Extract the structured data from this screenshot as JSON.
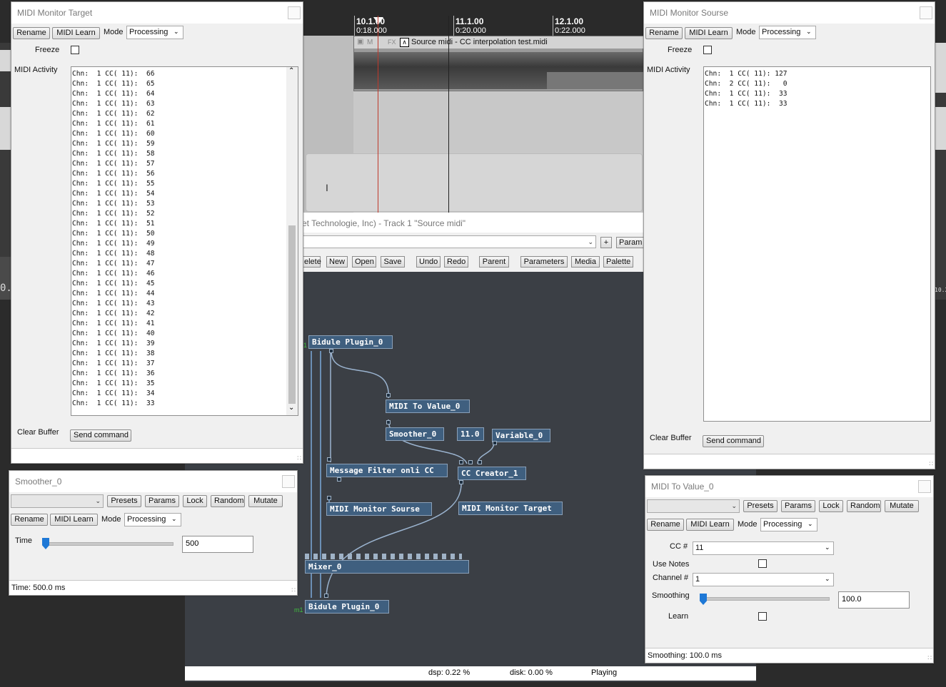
{
  "timeline": {
    "markers": [
      {
        "bar": "10.1.00",
        "time": "0:18.000"
      },
      {
        "bar": "11.1.00",
        "time": "0:20.000"
      },
      {
        "bar": "12.1.00",
        "time": "0:22.000"
      }
    ],
    "item_flags": "M",
    "item_fx": "FX",
    "item_title": "Source midi - CC interpolation test.midi",
    "left_number": "0.",
    "right_number": "10.2"
  },
  "bidule": {
    "title": "et Technologie, Inc) - Track 1 \"Source midi\"",
    "add_label": "+",
    "param_label": "Param",
    "toolbar": {
      "delete": "elete",
      "new": "New",
      "open": "Open",
      "save": "Save",
      "undo": "Undo",
      "redo": "Redo",
      "parent": "Parent",
      "parameters": "Parameters",
      "media": "Media",
      "palette": "Palette"
    },
    "nodes": {
      "bidule_plugin_top": "Bidule Plugin_0",
      "midi_to_value": "MIDI To Value_0",
      "smoother": "Smoother_0",
      "const_value": "11.0",
      "variable": "Variable_0",
      "message_filter": "Message Filter onli CC",
      "cc_creator": "CC Creator_1",
      "midi_monitor_sourse": "MIDI Monitor Sourse",
      "midi_monitor_target": "MIDI Monitor Target",
      "mixer": "Mixer_0",
      "bidule_plugin_bottom": "Bidule Plugin_0"
    },
    "port_marks": {
      "top": "1",
      "bottom": "m1"
    },
    "status": {
      "dsp": "dsp:  0.22 %",
      "disk": "disk:  0.00 %",
      "state": "Playing"
    }
  },
  "monitor_target": {
    "title": "MIDI Monitor Target",
    "rename": "Rename",
    "midi_learn": "MIDI Learn",
    "mode_label": "Mode",
    "mode_value": "Processing",
    "freeze_label": "Freeze",
    "activity_label": "MIDI Activity",
    "lines": [
      "Chn:  1 CC( 11):  66",
      "Chn:  1 CC( 11):  65",
      "Chn:  1 CC( 11):  64",
      "Chn:  1 CC( 11):  63",
      "Chn:  1 CC( 11):  62",
      "Chn:  1 CC( 11):  61",
      "Chn:  1 CC( 11):  60",
      "Chn:  1 CC( 11):  59",
      "Chn:  1 CC( 11):  58",
      "Chn:  1 CC( 11):  57",
      "Chn:  1 CC( 11):  56",
      "Chn:  1 CC( 11):  55",
      "Chn:  1 CC( 11):  54",
      "Chn:  1 CC( 11):  53",
      "Chn:  1 CC( 11):  52",
      "Chn:  1 CC( 11):  51",
      "Chn:  1 CC( 11):  50",
      "Chn:  1 CC( 11):  49",
      "Chn:  1 CC( 11):  48",
      "Chn:  1 CC( 11):  47",
      "Chn:  1 CC( 11):  46",
      "Chn:  1 CC( 11):  45",
      "Chn:  1 CC( 11):  44",
      "Chn:  1 CC( 11):  43",
      "Chn:  1 CC( 11):  42",
      "Chn:  1 CC( 11):  41",
      "Chn:  1 CC( 11):  40",
      "Chn:  1 CC( 11):  39",
      "Chn:  1 CC( 11):  38",
      "Chn:  1 CC( 11):  37",
      "Chn:  1 CC( 11):  36",
      "Chn:  1 CC( 11):  35",
      "Chn:  1 CC( 11):  34",
      "Chn:  1 CC( 11):  33"
    ],
    "clear_label": "Clear Buffer",
    "send_command": "Send command"
  },
  "monitor_source": {
    "title": "MIDI Monitor Sourse",
    "rename": "Rename",
    "midi_learn": "MIDI Learn",
    "mode_label": "Mode",
    "mode_value": "Processing",
    "freeze_label": "Freeze",
    "activity_label": "MIDI Activity",
    "lines": [
      "Chn:  1 CC( 11): 127",
      "Chn:  2 CC( 11):   0",
      "Chn:  1 CC( 11):  33",
      "Chn:  1 CC( 11):  33"
    ],
    "clear_label": "Clear Buffer",
    "send_command": "Send command"
  },
  "smoother": {
    "title": "Smoother_0",
    "presets": "Presets",
    "params": "Params",
    "lock": "Lock",
    "random": "Random",
    "mutate": "Mutate",
    "rename": "Rename",
    "midi_learn": "MIDI Learn",
    "mode_label": "Mode",
    "mode_value": "Processing",
    "time_label": "Time",
    "time_value": "500",
    "time_level": 0,
    "status": "Time: 500.0 ms"
  },
  "midi_to_value": {
    "title": "MIDI To Value_0",
    "presets": "Presets",
    "params": "Params",
    "lock": "Lock",
    "random": "Random",
    "mutate": "Mutate",
    "rename": "Rename",
    "midi_learn": "MIDI Learn",
    "mode_label": "Mode",
    "mode_value": "Processing",
    "cc_label": "CC #",
    "cc_value": "11",
    "use_notes_label": "Use Notes",
    "channel_label": "Channel #",
    "channel_value": "1",
    "smoothing_label": "Smoothing",
    "smoothing_value": "100.0",
    "smoothing_level": 0,
    "learn_label": "Learn",
    "status": "Smoothing: 100.0 ms"
  }
}
